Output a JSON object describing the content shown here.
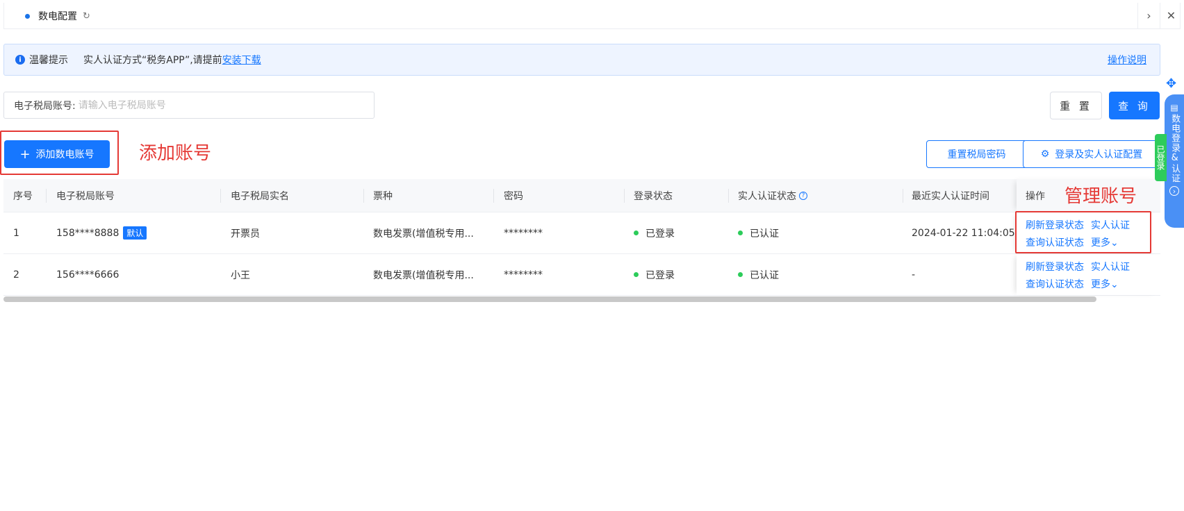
{
  "tab": {
    "label": "数电配置",
    "refresh_icon": "↻",
    "next_icon": "›",
    "close_icon": "✕"
  },
  "notice": {
    "icon": "i",
    "title": "温馨提示",
    "text": "实人认证方式“税务APP”,请提前",
    "download_link": "安装下载",
    "help_link": "操作说明"
  },
  "search": {
    "label": "电子税局账号:",
    "placeholder": "请输入电子税局账号",
    "value": "",
    "reset_label": "重 置",
    "query_label": "查 询"
  },
  "actions": {
    "add_icon": "+",
    "add_label": "添加数电账号",
    "reset_password_label": "重置税局密码",
    "config_icon": "⚙",
    "config_label": "登录及实人认证配置"
  },
  "annotations": {
    "add_note": "添加账号",
    "manage_note": "管理账号",
    "color": "#e53935"
  },
  "table": {
    "columns": [
      "序号",
      "电子税局账号",
      "电子税局实名",
      "票种",
      "密码",
      "登录状态",
      "实人认证状态",
      "最近实人认证时间",
      "操作"
    ],
    "help_icon": "?",
    "rows": [
      {
        "index": "1",
        "account": "158****8888",
        "badge": "默认",
        "real_name": "开票员",
        "ticket_type": "数电发票(增值税专用...",
        "password": "********",
        "login_status": "已登录",
        "auth_status": "已认证",
        "last_auth_time": "2024-01-22 11:04:05",
        "ops": {
          "refresh_login": "刷新登录状态",
          "real_auth": "实人认证",
          "query_auth": "查询认证状态",
          "more": "更多"
        }
      },
      {
        "index": "2",
        "account": "156****6666",
        "badge": "",
        "real_name": "小王",
        "ticket_type": "数电发票(增值税专用...",
        "password": "********",
        "login_status": "已登录",
        "auth_status": "已认证",
        "last_auth_time": "-",
        "ops": {
          "refresh_login": "刷新登录状态",
          "real_auth": "实人认证",
          "query_auth": "查询认证状态",
          "more": "更多"
        }
      }
    ],
    "more_icon": "⌄"
  },
  "side_widget": {
    "move_icon": "✥",
    "book_icon": "▤",
    "label": "数电登录&认证",
    "arrow_icon": "›",
    "status": "已登录"
  },
  "colors": {
    "primary": "#1677ff",
    "success": "#2ccc5a",
    "annotation": "#e53935"
  }
}
